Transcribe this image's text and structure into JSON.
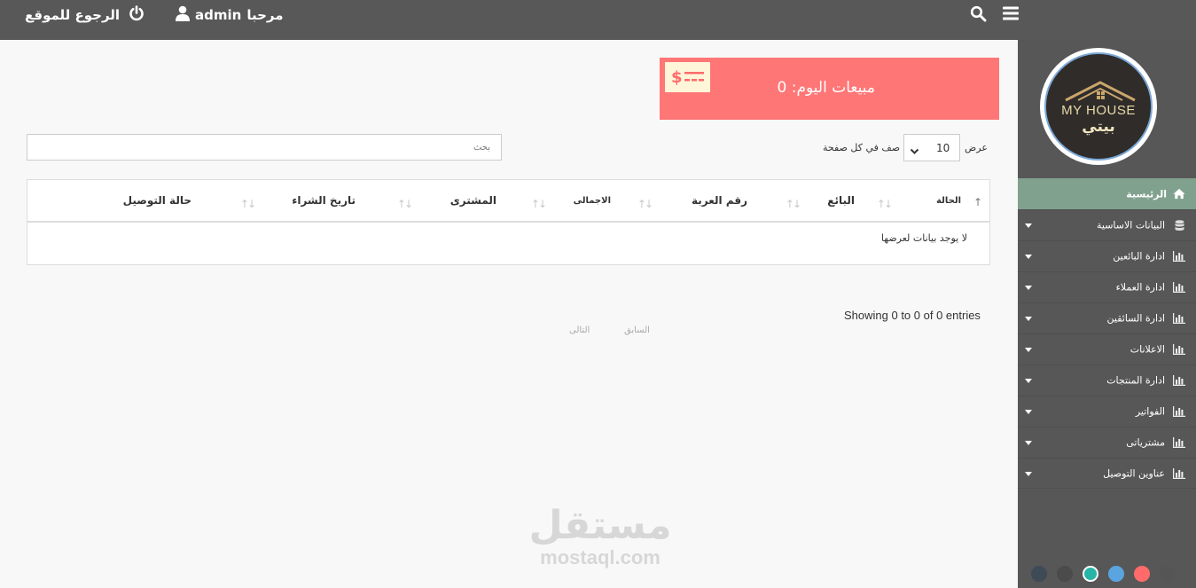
{
  "header": {
    "back_label": "الرجوع للموقع",
    "welcome_label": "مرحبا",
    "username": "admin",
    "icons": [
      "power-icon",
      "user-icon",
      "search-icon",
      "hamburger-icon"
    ]
  },
  "sidebar": {
    "logo": {
      "text_en": "MY HOUSE",
      "text_ar": "بيتي"
    },
    "items": [
      {
        "label": "الرئيسية",
        "icon": "home-icon",
        "active": true
      },
      {
        "label": "البيانات الاساسية",
        "icon": "database-icon"
      },
      {
        "label": "ادارة البائعين",
        "icon": "bar-chart-icon"
      },
      {
        "label": "ادارة العملاء",
        "icon": "bar-chart-icon"
      },
      {
        "label": "ادارة السائقين",
        "icon": "bar-chart-icon"
      },
      {
        "label": "الاعلانات",
        "icon": "bar-chart-icon"
      },
      {
        "label": "ادارة المنتجات",
        "icon": "bar-chart-icon"
      },
      {
        "label": "الفواتير",
        "icon": "bar-chart-icon"
      },
      {
        "label": "مشترياتى",
        "icon": "bar-chart-icon"
      },
      {
        "label": "عناوين التوصيل",
        "icon": "bar-chart-icon"
      }
    ],
    "theme_colors": [
      "#3f4a57",
      "#4b4b4b",
      "#26b5a6",
      "#5aa5e0",
      "#ff6b6b",
      "#555555"
    ],
    "selected_theme_index": 2
  },
  "sales_card": {
    "label": "مبيعات اليوم: 0",
    "icon": "money-icon",
    "bg_color": "#ff7676"
  },
  "controls": {
    "show_label": "عرض",
    "per_page_label": "صف في كل صفحة",
    "page_length": "10",
    "search_placeholder": "بحث"
  },
  "table": {
    "columns": [
      "الحالة",
      "البائع",
      "رقم العربة",
      "الاجمالى",
      "المشترى",
      "تاريخ الشراء",
      "حالة التوصيل"
    ],
    "rows": [],
    "empty_message": "لا يوجد بيانات لعرضها"
  },
  "footer": {
    "info": "Showing 0 to 0 of 0 entries",
    "prev_label": "السابق",
    "next_label": "التالى"
  },
  "watermark": {
    "ar": "مستقل",
    "en": "mostaql.com"
  }
}
